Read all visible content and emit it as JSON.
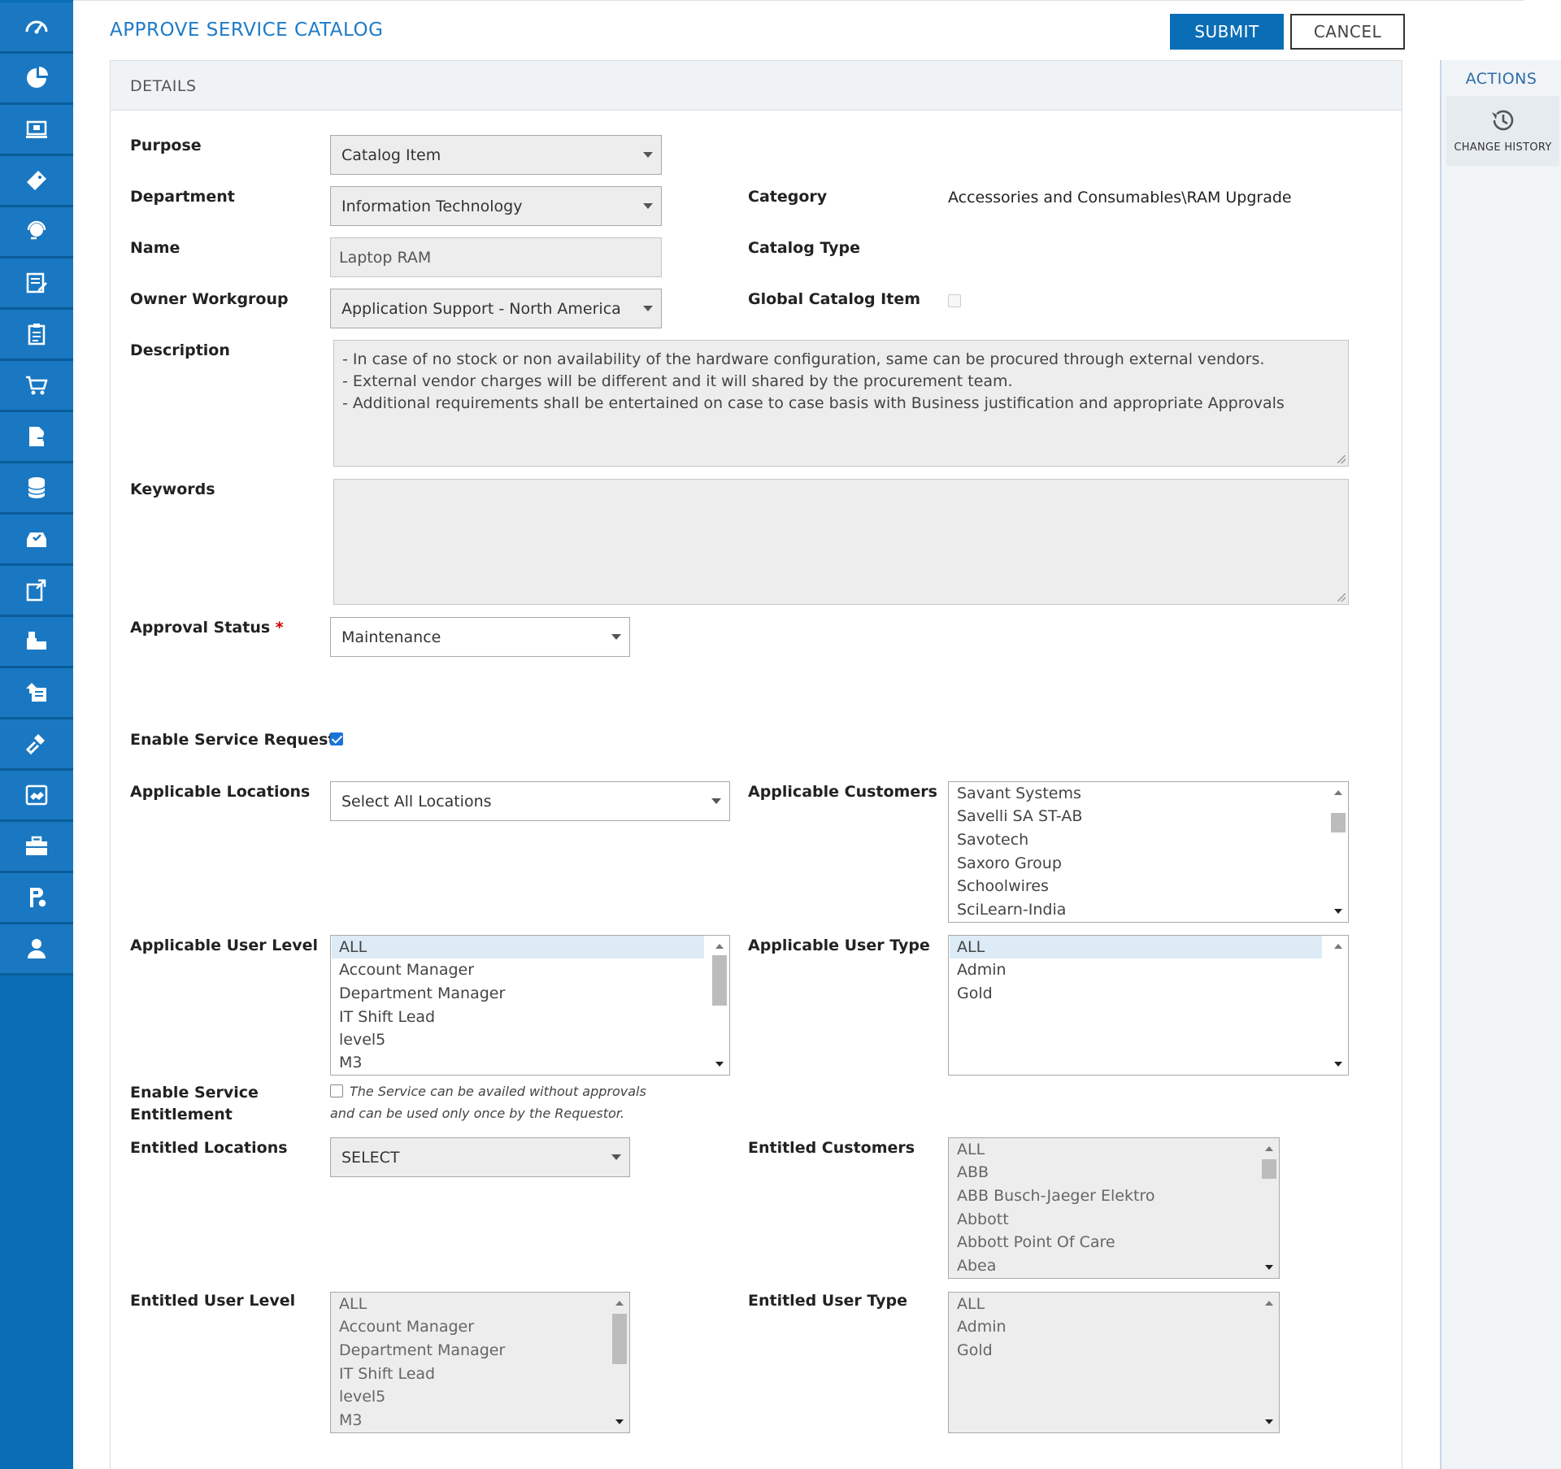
{
  "header": {
    "title": "APPROVE SERVICE CATALOG",
    "submit_label": "SUBMIT",
    "cancel_label": "CANCEL"
  },
  "panel": {
    "title": "DETAILS"
  },
  "sidebar": {
    "icons": [
      "dashboard-icon",
      "pie-chart-icon",
      "monitor-icon",
      "ticket-icon",
      "headset-icon",
      "edit-form-icon",
      "clipboard-icon",
      "cart-icon",
      "document-share-icon",
      "database-icon",
      "inbox-check-icon",
      "note-export-icon",
      "puzzle-icon",
      "upload-docs-icon",
      "gavel-icon",
      "handshake-icon",
      "briefcase-icon",
      "parking-icon",
      "user-icon"
    ]
  },
  "colors": {
    "accent": "#0a6eb6",
    "title": "#1e7bc8",
    "rail": "#0a6eb6",
    "required": "#cc0000"
  },
  "form": {
    "purpose": {
      "label": "Purpose",
      "value": "Catalog Item"
    },
    "department": {
      "label": "Department",
      "value": "Information Technology"
    },
    "category": {
      "label": "Category",
      "value": "Accessories and Consumables\\RAM Upgrade"
    },
    "name": {
      "label": "Name",
      "value": "Laptop RAM"
    },
    "catalog_type": {
      "label": "Catalog Type",
      "value": ""
    },
    "owner_workgroup": {
      "label": "Owner Workgroup",
      "value": "Application Support - North America"
    },
    "global_catalog_item": {
      "label": "Global Catalog Item",
      "checked": false
    },
    "description": {
      "label": "Description",
      "lines": [
        "- In case of no stock or non availability of the hardware configuration, same can be procured through external vendors.",
        "- External vendor charges will be different and it will shared by the procurement team.",
        "- Additional requirements shall be entertained on case to case basis with Business justification and appropriate Approvals"
      ]
    },
    "keywords": {
      "label": "Keywords",
      "value": ""
    },
    "approval_status": {
      "label": "Approval Status",
      "required_mark": "*",
      "value": "Maintenance"
    },
    "enable_service_request": {
      "label": "Enable Service Request",
      "checked": true
    },
    "applicable_locations": {
      "label": "Applicable Locations",
      "value": "Select All Locations"
    },
    "applicable_customers": {
      "label": "Applicable Customers",
      "options": [
        "Savant Systems",
        "Savelli SA ST-AB",
        "Savotech",
        "Saxoro Group",
        "Schoolwires",
        "SciLearn-India"
      ]
    },
    "applicable_user_level": {
      "label": "Applicable User Level",
      "options": [
        "ALL",
        "Account Manager",
        "Department Manager",
        "IT Shift Lead",
        "level5",
        "M3"
      ],
      "selected": "ALL"
    },
    "applicable_user_type": {
      "label": "Applicable User Type",
      "options": [
        "ALL",
        "Admin",
        "Gold"
      ],
      "selected": "ALL"
    },
    "enable_service_entitlement": {
      "label_line1": "Enable Service",
      "label_line2": "Entitlement",
      "checked": false,
      "note_line1": "The Service can be availed without approvals",
      "note_line2": "and can be used only once by the Requestor."
    },
    "entitled_locations": {
      "label": "Entitled Locations",
      "value": "SELECT"
    },
    "entitled_customers": {
      "label": "Entitled Customers",
      "options": [
        "ALL",
        "ABB",
        "ABB Busch-Jaeger Elektro",
        "Abbott",
        "Abbott Point Of Care",
        "Abea"
      ]
    },
    "entitled_user_level": {
      "label": "Entitled User Level",
      "options": [
        "ALL",
        "Account Manager",
        "Department Manager",
        "IT Shift Lead",
        "level5",
        "M3"
      ]
    },
    "entitled_user_type": {
      "label": "Entitled User Type",
      "options": [
        "ALL",
        "Admin",
        "Gold"
      ]
    }
  },
  "actions": {
    "title": "ACTIONS",
    "change_history_label": "CHANGE HISTORY"
  }
}
